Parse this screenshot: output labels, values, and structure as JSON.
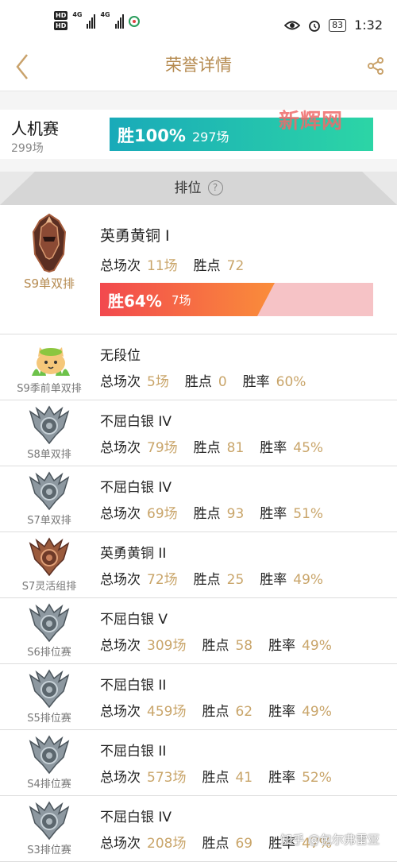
{
  "status": {
    "signal_a": "4G",
    "signal_b": "4G",
    "battery": "83",
    "time": "1:32"
  },
  "nav": {
    "title": "荣誉详情"
  },
  "ai_match": {
    "name": "人机赛",
    "count": "299场",
    "win_pct": "胜100%",
    "win_count": "297场"
  },
  "watermark": "新辉网",
  "rank_header": {
    "label": "排位",
    "help_glyph": "?"
  },
  "labels": {
    "total": "总场次",
    "points": "胜点",
    "rate": "胜率"
  },
  "featured": {
    "season": "S9单双排",
    "rank": "英勇黄铜 I",
    "total": "11场",
    "points": "72",
    "win_pct": "胜64%",
    "win_count": "7场",
    "win_fraction": 0.64
  },
  "rows": [
    {
      "season": "S9季前单双排",
      "rank": "无段位",
      "total": "5场",
      "points": "0",
      "rate": "60%",
      "emblem": "cat"
    },
    {
      "season": "S8单双排",
      "rank": "不屈白银 IV",
      "total": "79场",
      "points": "81",
      "rate": "45%",
      "emblem": "silver"
    },
    {
      "season": "S7单双排",
      "rank": "不屈白银 IV",
      "total": "69场",
      "points": "93",
      "rate": "51%",
      "emblem": "silver"
    },
    {
      "season": "S7灵活组排",
      "rank": "英勇黄铜 II",
      "total": "72场",
      "points": "25",
      "rate": "49%",
      "emblem": "bronze"
    },
    {
      "season": "S6排位赛",
      "rank": "不屈白银 V",
      "total": "309场",
      "points": "58",
      "rate": "49%",
      "emblem": "silver"
    },
    {
      "season": "S5排位赛",
      "rank": "不屈白银 II",
      "total": "459场",
      "points": "62",
      "rate": "49%",
      "emblem": "silver"
    },
    {
      "season": "S4排位赛",
      "rank": "不屈白银 II",
      "total": "573场",
      "points": "41",
      "rate": "52%",
      "emblem": "silver"
    },
    {
      "season": "S3排位赛",
      "rank": "不屈白银 IV",
      "total": "208场",
      "points": "69",
      "rate": "47%",
      "emblem": "silver"
    }
  ],
  "corner_watermark": "知乎 @包尔弗雷亚",
  "colors": {
    "accent": "#c9a26b",
    "ai_bar": "#19aab9",
    "win_bar": "#f2494e"
  }
}
